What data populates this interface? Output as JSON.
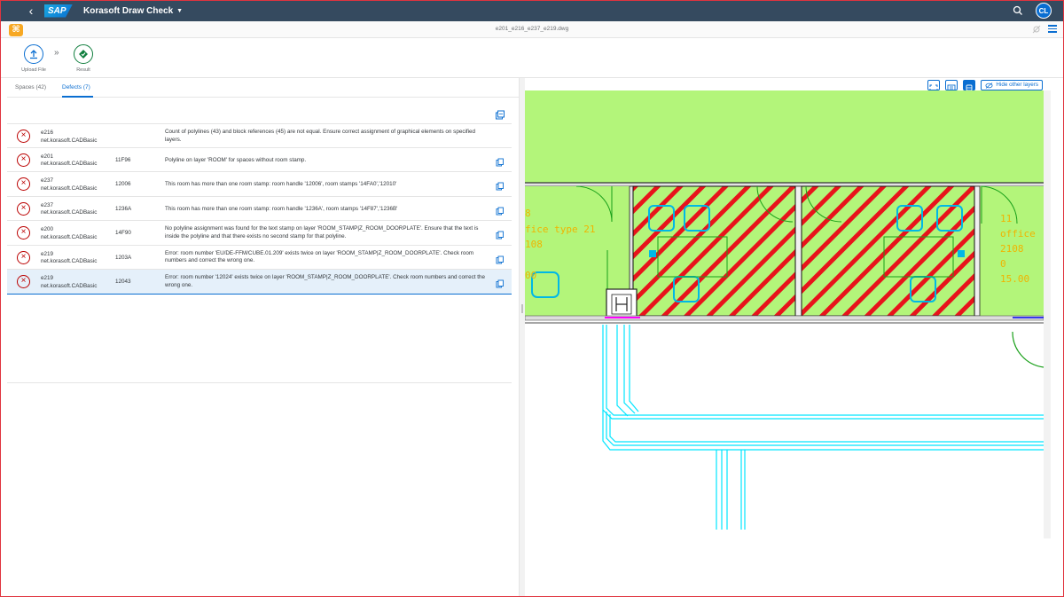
{
  "shell": {
    "logo": "SAP",
    "title": "Korasoft Draw Check",
    "avatar": "CL"
  },
  "subbar": {
    "file_name": "e201_e216_e237_e219.dwg",
    "app_icon": "⌘"
  },
  "process": {
    "upload_label": "Upload File",
    "result_label": "Result"
  },
  "tabs": [
    {
      "label": "Spaces (42)",
      "active": false
    },
    {
      "label": "Defects (7)",
      "active": true
    }
  ],
  "defects": [
    {
      "code": "e216",
      "source": "net.korasoft.CADBasic",
      "handle": "",
      "message": "Count of polylines (43) and block references (45) are not equal. Ensure correct assignment of graphical elements on specified layers.",
      "has_action": false,
      "selected": false
    },
    {
      "code": "e201",
      "source": "net.korasoft.CADBasic",
      "handle": "11F96",
      "message": "Polyline on layer 'ROOM' for spaces without room stamp.",
      "has_action": true,
      "selected": false
    },
    {
      "code": "e237",
      "source": "net.korasoft.CADBasic",
      "handle": "12006",
      "message": "This room has more than one room stamp: room handle '12006', room stamps '14FA0','12010'",
      "has_action": true,
      "selected": false
    },
    {
      "code": "e237",
      "source": "net.korasoft.CADBasic",
      "handle": "1236A",
      "message": "This room has more than one room stamp: room handle '1236A', room stamps '14F87','1236B'",
      "has_action": true,
      "selected": false
    },
    {
      "code": "e200",
      "source": "net.korasoft.CADBasic",
      "handle": "14F90",
      "message": "No polyline assignment was found for the text stamp on layer 'ROOM_STAMP|Z_ROOM_DOORPLATE'. Ensure that the text is inside the polyline and that there exists no second stamp for that polyline.",
      "has_action": true,
      "selected": false
    },
    {
      "code": "e219",
      "source": "net.korasoft.CADBasic",
      "handle": "1203A",
      "message": "Error: room number 'EU/DE-FFM/CUBE.01.209' exists twice on layer 'ROOM_STAMP|Z_ROOM_DOORPLATE'. Check room numbers and correct the wrong one.",
      "has_action": true,
      "selected": false
    },
    {
      "code": "e219",
      "source": "net.korasoft.CADBasic",
      "handle": "12043",
      "message": "Error: room number '12024' exists twice on layer 'ROOM_STAMP|Z_ROOM_DOORPLATE'. Check room numbers and correct the wrong one.",
      "has_action": true,
      "selected": true
    }
  ],
  "drawing": {
    "hide_layers_label": "Hide other layers",
    "room_left_label1": "fice type 21",
    "room_left_label2": "108",
    "room_left_label3": "00",
    "room_left_label0": "8",
    "room_right_label1": "11",
    "room_right_label2": "office",
    "room_right_label3": "2108",
    "room_right_label4": "0",
    "room_right_label5": "15.00"
  },
  "colors": {
    "shell": "#354a5f",
    "accent": "#0a6ed1",
    "error": "#bb0000",
    "room_fill": "#b3f57a",
    "hatch": "#e8131b",
    "cyan": "#00e5ff",
    "text_label": "#f0b400"
  }
}
